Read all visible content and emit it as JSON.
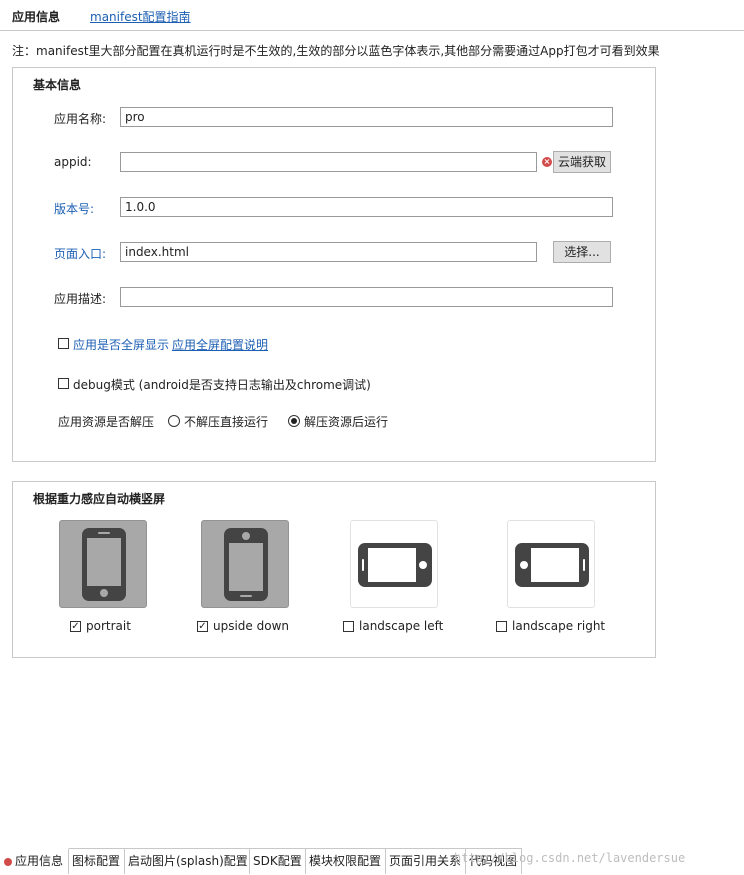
{
  "header": {
    "title": "应用信息",
    "guide_link": "manifest配置指南"
  },
  "note": "注：manifest里大部分配置在真机运行时是不生效的,生效的部分以蓝色字体表示,其他部分需要通过App打包才可看到效果",
  "basic": {
    "title": "基本信息",
    "app_name_label": "应用名称:",
    "app_name_value": "pro",
    "appid_label": "appid:",
    "appid_value": "",
    "cloud_button": "云端获取",
    "version_label": "版本号:",
    "version_value": "1.0.0",
    "entry_label": "页面入口:",
    "entry_value": "index.html",
    "choose_button": "选择...",
    "desc_label": "应用描述:",
    "desc_value": "",
    "fullscreen_label": "应用是否全屏显示",
    "fullscreen_link": "应用全屏配置说明",
    "fullscreen_checked": false,
    "debug_label": "debug模式 (android是否支持日志输出及chrome调试)",
    "debug_checked": false,
    "unpack_label": "应用资源是否解压",
    "unpack_option_1": "不解压直接运行",
    "unpack_option_2": "解压资源后运行",
    "unpack_selected": "解压资源后运行"
  },
  "orientation": {
    "title": "根据重力感应自动横竖屏",
    "options": [
      {
        "label": "portrait",
        "checked": true,
        "icon": "portrait-phone-icon"
      },
      {
        "label": "upside down",
        "checked": true,
        "icon": "upside-down-phone-icon"
      },
      {
        "label": "landscape left",
        "checked": false,
        "icon": "landscape-left-phone-icon"
      },
      {
        "label": "landscape right",
        "checked": false,
        "icon": "landscape-right-phone-icon"
      }
    ]
  },
  "tabs": [
    {
      "label": "应用信息",
      "active": true
    },
    {
      "label": "图标配置",
      "active": false
    },
    {
      "label": "启动图片(splash)配置",
      "active": false
    },
    {
      "label": "SDK配置",
      "active": false
    },
    {
      "label": "模块权限配置",
      "active": false
    },
    {
      "label": "页面引用关系",
      "active": false
    },
    {
      "label": "代码视图",
      "active": false
    }
  ],
  "watermark": "http://blog.csdn.net/lavendersue",
  "colors": {
    "accent": "#1c5fb3",
    "selected_tile": "#a8a8a8",
    "error": "#d24b4b"
  }
}
